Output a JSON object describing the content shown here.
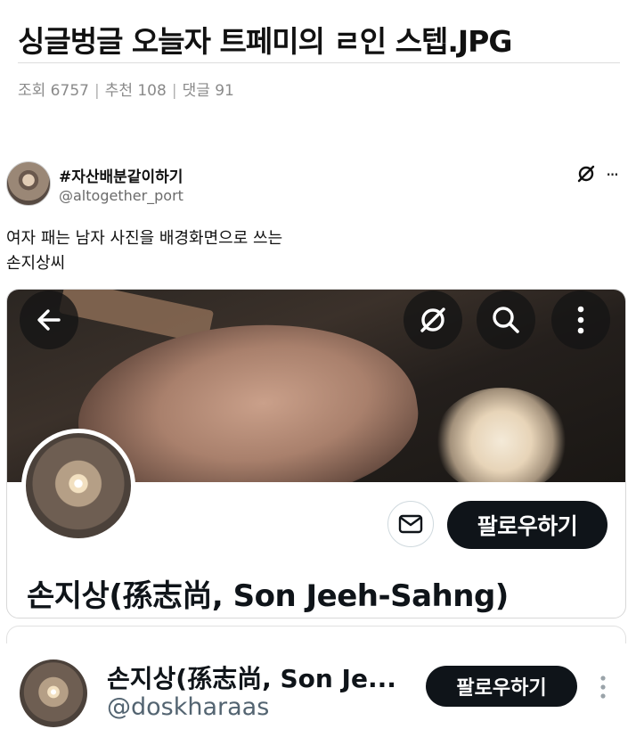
{
  "post": {
    "title": "싱글벙글 오늘자 트페미의 ㄹ인 스텝.JPG",
    "views_label": "조회 6757",
    "recommend_label": "추천 108",
    "comments_label": "댓글 91",
    "separator": "|"
  },
  "tweet": {
    "display_name": "#자산배분같이하기",
    "handle": "@altogether_port",
    "text": "여자 패는 남자 사진을 배경화면으로 쓰는\n손지상씨",
    "more_glyph": "···"
  },
  "profile_screenshot": {
    "name": "손지상(孫志尚, Son Jeeh-Sahng)",
    "follow_label": "팔로우하기"
  },
  "suggested": {
    "name": "손지상(孫志尚, Son Je...",
    "handle": "@doskharaas",
    "follow_label": "팔로우하기"
  },
  "icons": {
    "tweet_x": "x-slash-icon",
    "tweet_more": "more-horizontal-icon",
    "back": "arrow-left-icon",
    "header_x": "x-slash-icon",
    "search": "search-icon",
    "menu": "more-vertical-icon",
    "mail": "mail-icon",
    "suggested_more": "more-vertical-icon"
  }
}
